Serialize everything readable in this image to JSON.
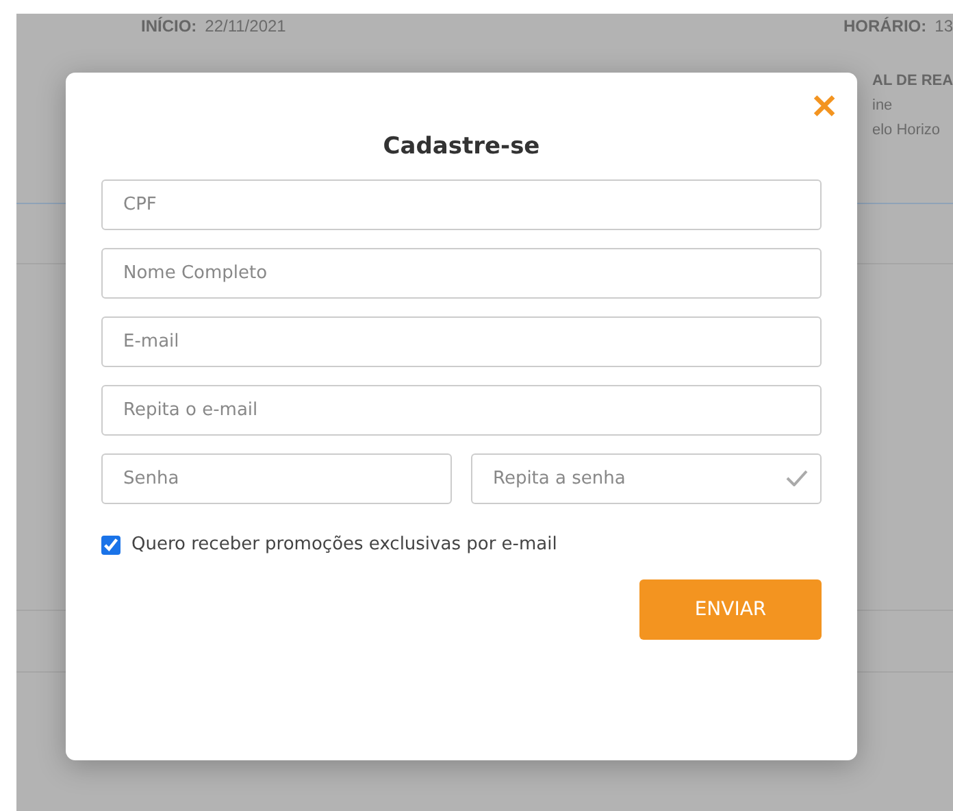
{
  "background": {
    "start_label": "INÍCIO:",
    "start_value": "22/11/2021",
    "time_label": "HORÁRIO:",
    "time_value": "13",
    "place_label": "AL DE REA",
    "place_lines": [
      "ine",
      "elo Horizo"
    ]
  },
  "modal": {
    "title": "Cadastre-se",
    "close": "✕",
    "fields": [
      {
        "placeholder": "CPF",
        "half": false,
        "valid": false
      },
      {
        "placeholder": "Nome Completo",
        "half": false,
        "valid": false
      },
      {
        "placeholder": "E-mail",
        "half": false,
        "valid": false
      },
      {
        "placeholder": "Repita o e-mail",
        "half": false,
        "valid": false
      },
      {
        "placeholder": "Senha",
        "half": true,
        "valid": false
      },
      {
        "placeholder": "Repita a senha",
        "half": true,
        "valid": true
      }
    ],
    "optin": {
      "label": "Quero receber promoções exclusivas por e-mail",
      "checked": true
    },
    "submit": "ENVIAR"
  }
}
